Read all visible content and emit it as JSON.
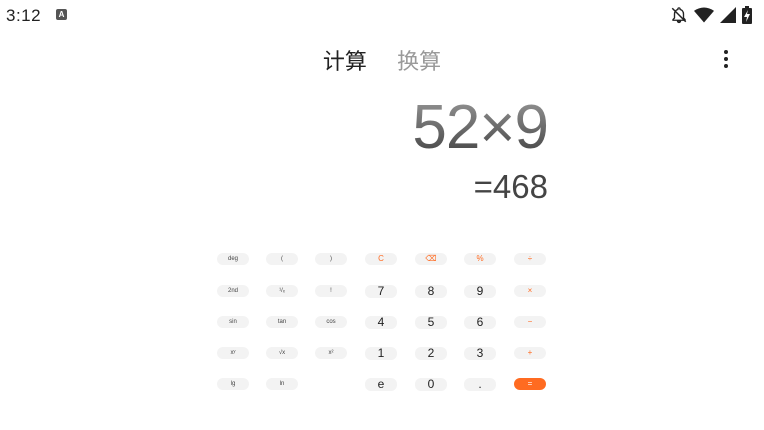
{
  "status_bar": {
    "time": "3:12",
    "app_icon_letter": "A",
    "icons": [
      "notifications-off-icon",
      "wifi-icon",
      "cellular-signal-icon",
      "battery-charging-icon"
    ]
  },
  "tabs": [
    {
      "label": "计算",
      "active": true
    },
    {
      "label": "换算",
      "active": false
    }
  ],
  "display": {
    "expression": "52×9",
    "result": "=468"
  },
  "keys": {
    "deg": "deg",
    "open_paren": "(",
    "close_paren": ")",
    "clear": "C",
    "backspace": "⌫",
    "percent": "%",
    "divide": "÷",
    "second": "2nd",
    "reciprocal": "¹/ₓ",
    "factorial": "!",
    "seven": "7",
    "eight": "8",
    "nine": "9",
    "multiply": "×",
    "sin": "sin",
    "tan": "tan",
    "cos": "cos",
    "four": "4",
    "five": "5",
    "six": "6",
    "minus": "−",
    "power": "xʸ",
    "sqrt": "√x",
    "square": "x²",
    "one": "1",
    "two": "2",
    "three": "3",
    "plus": "+",
    "lg": "lg",
    "ln": "ln",
    "e": "e",
    "zero": "0",
    "dot": ".",
    "equals": "="
  },
  "colors": {
    "accent": "#ff6b21",
    "key_bg": "#f3f3f3"
  }
}
